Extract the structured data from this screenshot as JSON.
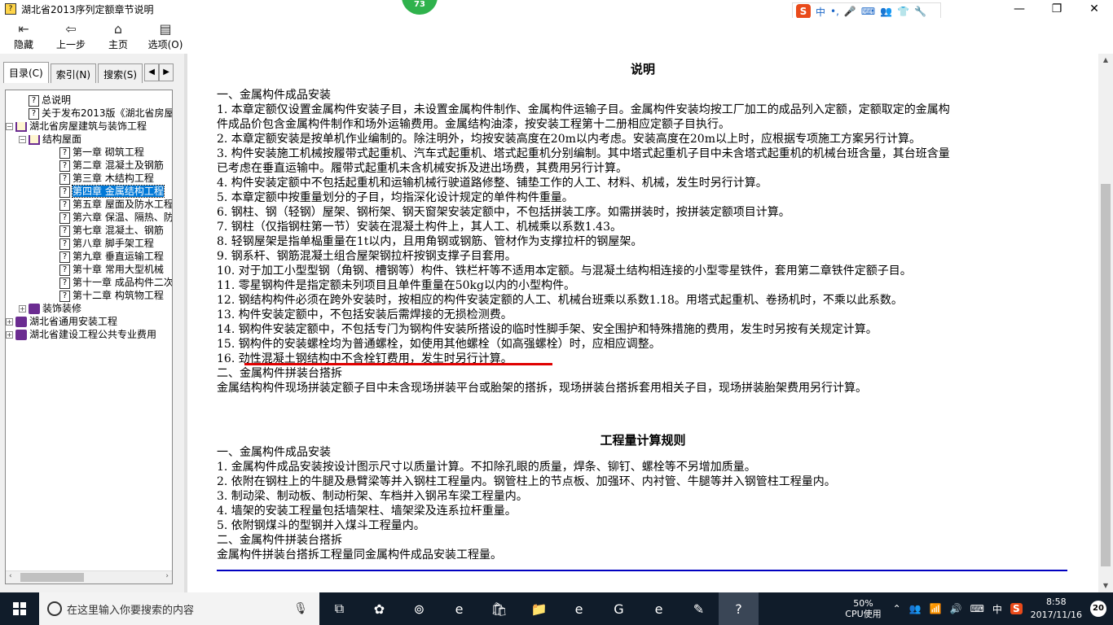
{
  "window": {
    "title": "湖北省2013序列定额章节说明",
    "minimize": "—",
    "restore": "❐",
    "close": "✕",
    "badge": "73"
  },
  "ime": {
    "logo": "S",
    "lang": "中",
    "items": [
      "•,",
      "🎤",
      "⌨",
      "👥",
      "👕",
      "🔧"
    ]
  },
  "toolbar": [
    {
      "label": "隐藏",
      "icon": "hide-icon",
      "glyph": "⇤"
    },
    {
      "label": "上一步",
      "icon": "back-arrow-icon",
      "glyph": "⇦"
    },
    {
      "label": "主页",
      "icon": "home-icon",
      "glyph": "⌂"
    },
    {
      "label": "选项(O)",
      "icon": "options-icon",
      "glyph": "▤"
    }
  ],
  "tabs": [
    {
      "label": "目录(C)",
      "active": true
    },
    {
      "label": "索引(N)",
      "active": false
    },
    {
      "label": "搜索(S)",
      "active": false
    }
  ],
  "tree": [
    {
      "label": "总说明",
      "level": 2,
      "icon": "q"
    },
    {
      "label": "关于发布2013版《湖北省房屋",
      "level": 2,
      "icon": "q"
    },
    {
      "label": "湖北省房屋建筑与装饰工程",
      "level": 0,
      "icon": "open",
      "exp": "−"
    },
    {
      "label": "结构屋面",
      "level": 1,
      "icon": "open",
      "exp": "−"
    },
    {
      "label": "第一章 砌筑工程",
      "level": 3,
      "icon": "q"
    },
    {
      "label": "第二章 混凝土及钢筋",
      "level": 3,
      "icon": "q"
    },
    {
      "label": "第三章 木结构工程",
      "level": 3,
      "icon": "q"
    },
    {
      "label": "第四章 金属结构工程",
      "level": 3,
      "icon": "q",
      "selected": true
    },
    {
      "label": "第五章 屋面及防水工程",
      "level": 3,
      "icon": "q"
    },
    {
      "label": "第六章 保温、隔热、防",
      "level": 3,
      "icon": "q"
    },
    {
      "label": "第七章 混凝土、钢筋",
      "level": 3,
      "icon": "q"
    },
    {
      "label": "第八章 脚手架工程",
      "level": 3,
      "icon": "q"
    },
    {
      "label": "第九章 垂直运输工程",
      "level": 3,
      "icon": "q"
    },
    {
      "label": "第十章 常用大型机械",
      "level": 3,
      "icon": "q"
    },
    {
      "label": "第十一章 成品构件二次",
      "level": 3,
      "icon": "q"
    },
    {
      "label": "第十二章 构筑物工程",
      "level": 3,
      "icon": "q"
    },
    {
      "label": "装饰装修",
      "level": 1,
      "icon": "book",
      "exp": "+"
    },
    {
      "label": "湖北省通用安装工程",
      "level": 0,
      "icon": "book",
      "exp": "+"
    },
    {
      "label": "湖北省建设工程公共专业费用",
      "level": 0,
      "icon": "book",
      "exp": "+"
    }
  ],
  "content": {
    "heading1": "说明",
    "lines1": [
      "一、金属构件成品安装",
      "1. 本章定额仅设置金属构件安装子目，未设置金属构件制作、金属构件运输子目。金属构件安装均按工厂加工的成品列入定额，定额取定的金属构",
      "件成品价包含金属构件制作和场外运输费用。金属结构油漆，按安装工程第十二册相应定额子目执行。",
      "2. 本章定额安装是按单机作业编制的。除注明外，均按安装高度在20m以内考虑。安装高度在20m以上时，应根据专项施工方案另行计算。",
      "3. 构件安装施工机械按履带式起重机、汽车式起重机、塔式起重机分别编制。其中塔式起重机子目中未含塔式起重机的机械台班含量，其台班含量",
      "已考虑在垂直运输中。履带式起重机未含机械安拆及进出场费，其费用另行计算。",
      "4. 构件安装定额中不包括起重机和运输机械行驶道路修整、铺垫工作的人工、材料、机械，发生时另行计算。",
      "5. 本章定额中按重量划分的子目，均指深化设计规定的单件构件重量。",
      "6. 钢柱、钢（轻钢）屋架、钢桁架、钢天窗架安装定额中，不包括拼装工序。如需拼装时，按拼装定额项目计算。",
      "7. 钢柱（仅指钢柱第一节）安装在混凝土构件上，其人工、机械乘以系数1.43。",
      "8. 轻钢屋架是指单榀重量在1t以内，且用角钢或钢筋、管材作为支撑拉杆的钢屋架。",
      "9. 钢系杆、钢筋混凝土组合屋架钢拉杆按钢支撑子目套用。",
      "10. 对于加工小型型钢（角钢、槽钢等）构件、铁栏杆等不适用本定额。与混凝土结构相连接的小型零星铁件，套用第二章铁件定额子目。",
      "11. 零星钢构件是指定额未列项目且单件重量在50kg以内的小型构件。",
      "12. 钢结构构件必须在跨外安装时，按相应的构件安装定额的人工、机械台班乘以系数1.18。用塔式起重机、卷扬机时，不乘以此系数。",
      "13. 构件安装定额中，不包括安装后需焊接的无损检测费。",
      "14. 钢构件安装定额中，不包括专门为钢构件安装所搭设的临时性脚手架、安全围护和特殊措施的费用，发生时另按有关规定计算。",
      "15. 钢构件的安装螺栓均为普通螺栓，如使用其他螺栓（如高强螺栓）时，应相应调整。",
      "16. 劲性混凝土钢结构中不含栓钉费用，发生时另行计算。",
      "二、金属构件拼装台搭拆",
      "金属结构构件现场拼装定额子目中未含现场拼装平台或胎架的搭拆，现场拼装台搭拆套用相关子目，现场拼装胎架费用另行计算。"
    ],
    "heading2": "工程量计算规则",
    "lines2": [
      "一、金属构件成品安装",
      "1. 金属构件成品安装按设计图示尺寸以质量计算。不扣除孔眼的质量，焊条、铆钉、螺栓等不另增加质量。",
      "2. 依附在钢柱上的牛腿及悬臂梁等并入钢柱工程量内。钢管柱上的节点板、加强环、内衬管、牛腿等并入钢管柱工程量内。",
      "3. 制动梁、制动板、制动桁架、车档并入钢吊车梁工程量内。",
      "4. 墙架的安装工程量包括墙架柱、墙架梁及连系拉杆重量。",
      "5. 依附钢煤斗的型钢并入煤斗工程量内。",
      "二、金属构件拼装台搭拆",
      "金属构件拼装台搭拆工程量同金属构件成品安装工程量。"
    ]
  },
  "taskbar": {
    "search_placeholder": "在这里输入你要搜索的内容",
    "apps": [
      "task-view-icon",
      "pinwheel-icon",
      "spiral-icon",
      "edge-icon",
      "store-icon",
      "folder-icon",
      "ie-icon",
      "g-icon",
      "e-icon",
      "notes-icon",
      "help-icon"
    ],
    "app_glyphs": [
      "⧉",
      "✿",
      "⊚",
      "e",
      "🛍",
      "📁",
      "e",
      "G",
      "e",
      "✎",
      "?"
    ],
    "cpu_percent": "50%",
    "cpu_label": "CPU使用",
    "lang": "中",
    "time": "8:58",
    "date": "2017/11/16",
    "notifications": "20"
  }
}
